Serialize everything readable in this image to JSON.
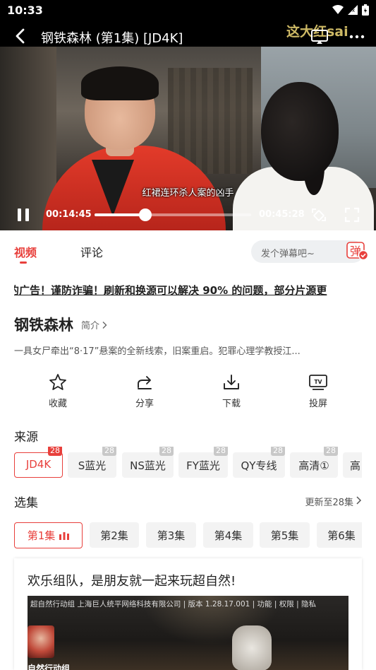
{
  "status_bar": {
    "time": "10:33"
  },
  "player": {
    "title": "钢铁森林 (第1集) [JD4K]",
    "watermark": "这大红sai",
    "subtitle": "红裙连环杀人案的凶手",
    "current_time": "00:14:45",
    "total_time": "00:45:28",
    "progress": 0.324
  },
  "tabs": {
    "video": "视频",
    "comments": "评论"
  },
  "danmu": {
    "placeholder": "发个弹幕吧~",
    "toggle_label": "弹"
  },
  "notice": "的广告！谨防诈骗！刷新和换源可以解决 90% 的问题，部分片源更",
  "show": {
    "title": "钢铁森林",
    "intro_label": "简介",
    "synopsis": "一具女尸牵出“8·17”悬案的全新线索，旧案重启。犯罪心理学教授江..."
  },
  "actions": [
    {
      "label": "收藏",
      "icon": "star-icon"
    },
    {
      "label": "分享",
      "icon": "share-icon"
    },
    {
      "label": "下载",
      "icon": "download-icon"
    },
    {
      "label": "投屏",
      "icon": "tv-cast-icon"
    }
  ],
  "sources": {
    "label": "来源",
    "items": [
      {
        "name": "JD4K",
        "count": "28",
        "active": true
      },
      {
        "name": "S蓝光",
        "count": "28"
      },
      {
        "name": "NS蓝光",
        "count": "28"
      },
      {
        "name": "FY蓝光",
        "count": "28"
      },
      {
        "name": "QY专线",
        "count": "28"
      },
      {
        "name": "高清①",
        "count": "28"
      },
      {
        "name": "高"
      }
    ]
  },
  "episodes": {
    "label": "选集",
    "update_text": "更新至28集",
    "items": [
      {
        "name": "第1集",
        "active": true
      },
      {
        "name": "第2集"
      },
      {
        "name": "第3集"
      },
      {
        "name": "第4集"
      },
      {
        "name": "第5集"
      },
      {
        "name": "第6集"
      }
    ]
  },
  "ad": {
    "title": "欢乐组队，是朋友就一起来玩超自然!",
    "meta": "超自然行动组 上海巨人统平网络科技有限公司 | 版本 1.28.17.001 | 功能 | 权限 | 隐私",
    "app_name": "自然行动组"
  },
  "colors": {
    "accent": "#e8403c",
    "watermark": "#d9c36b"
  }
}
